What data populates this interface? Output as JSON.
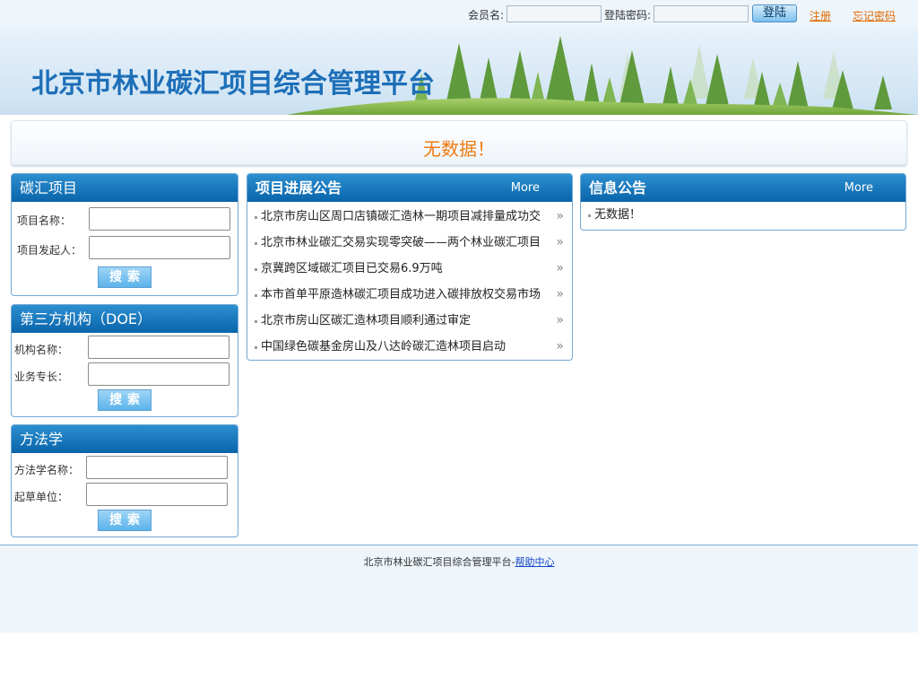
{
  "topbar": {
    "member_label": "会员名:",
    "password_label": "登陆密码:",
    "login_label": "登陆",
    "register_label": "注册",
    "forgot_label": "忘记密码"
  },
  "banner": {
    "title": "北京市林业碳汇项目综合管理平台"
  },
  "notice": {
    "text": "无数据！"
  },
  "carbon_projects": {
    "title": "碳汇项目",
    "name_label": "项目名称：",
    "sponsor_label": "项目发起人：",
    "search_label": "搜索"
  },
  "doe": {
    "title": "第三方机构（DOE）",
    "org_label": "机构名称：",
    "specialty_label": "业务专长：",
    "search_label": "搜索"
  },
  "methodology": {
    "title": "方法学",
    "name_label": "方法学名称：",
    "drafter_label": "起草单位：",
    "search_label": "搜索"
  },
  "progress_news": {
    "title": "项目进展公告",
    "more": "More",
    "items": [
      "北京市房山区周口店镇碳汇造林一期项目减排量成功交",
      "北京市林业碳汇交易实现零突破——两个林业碳汇项目",
      "京冀跨区域碳汇项目已交易6.9万吨",
      "本市首单平原造林碳汇项目成功进入碳排放权交易市场",
      "北京市房山区碳汇造林项目顺利通过审定",
      "中国绿色碳基金房山及八达岭碳汇造林项目启动"
    ]
  },
  "info_news": {
    "title": "信息公告",
    "more": "More",
    "items": [
      "无数据！"
    ]
  },
  "footer": {
    "text": "北京市林业碳汇项目综合管理平台-",
    "help_label": "帮助中心"
  },
  "colors": {
    "accent": "#1d6fb8",
    "panel_header": "#0a64aa",
    "notice_text": "#ef7b13",
    "link_orange": "#e06a00"
  }
}
